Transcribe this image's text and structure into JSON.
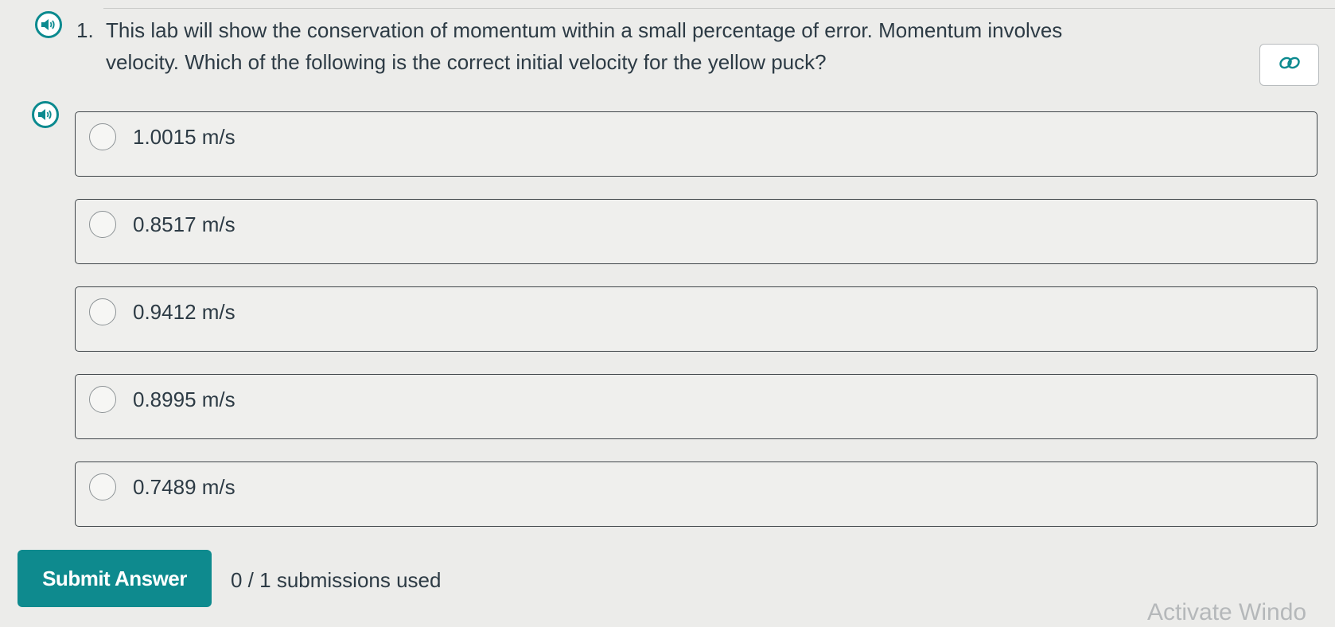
{
  "question": {
    "number": "1.",
    "text": "This lab will show the conservation of momentum within a small percentage of error. Momentum involves velocity. Which of the following is the correct initial velocity for the yellow puck?"
  },
  "icons": {
    "question_audio": "speaker-icon",
    "options_audio": "speaker-icon",
    "permalink": "link-icon"
  },
  "options": [
    {
      "label": "1.0015 m/s"
    },
    {
      "label": "0.8517 m/s"
    },
    {
      "label": "0.9412 m/s"
    },
    {
      "label": "0.8995 m/s"
    },
    {
      "label": "0.7489 m/s"
    }
  ],
  "footer": {
    "submit_label": "Submit Answer",
    "submissions_text": "0 / 1 submissions used"
  },
  "watermark": "Activate Windo",
  "colors": {
    "accent": "#0e8a8e",
    "text": "#2d3b45",
    "background": "#ececea"
  }
}
